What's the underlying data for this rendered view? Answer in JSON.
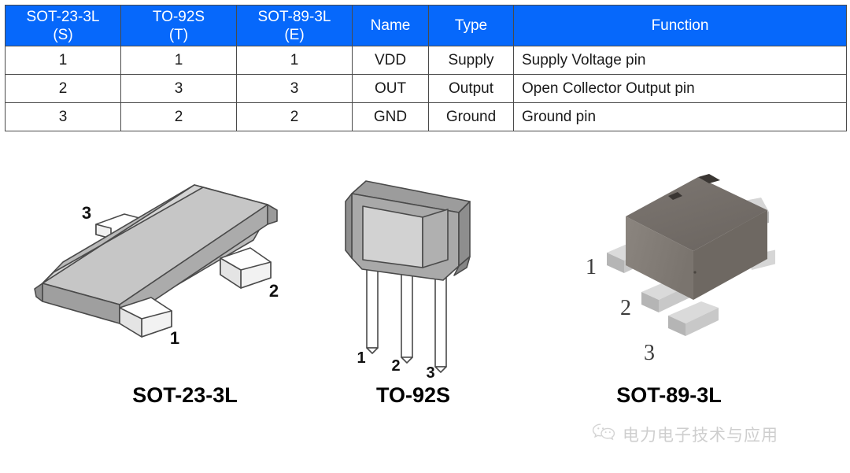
{
  "pin_table": {
    "headers": [
      {
        "line1": "SOT-23-3L",
        "line2": "(S)"
      },
      {
        "line1": "TO-92S",
        "line2": "(T)"
      },
      {
        "line1": "SOT-89-3L",
        "line2": "(E)"
      },
      {
        "line1": "Name",
        "line2": ""
      },
      {
        "line1": "Type",
        "line2": ""
      },
      {
        "line1": "Function",
        "line2": ""
      }
    ],
    "header_bg": "#0668fb",
    "header_fg": "#ffffff",
    "rows": [
      {
        "sot23": "1",
        "to92s": "1",
        "sot89": "1",
        "name": "VDD",
        "type": "Supply",
        "function": "Supply Voltage pin"
      },
      {
        "sot23": "2",
        "to92s": "3",
        "sot89": "3",
        "name": "OUT",
        "type": "Output",
        "function": "Open Collector Output pin"
      },
      {
        "sot23": "3",
        "to92s": "2",
        "sot89": "2",
        "name": "GND",
        "type": "Ground",
        "function": "Ground pin"
      }
    ]
  },
  "packages": [
    {
      "id": "sot-23-3l",
      "label": "SOT-23-3L",
      "pin_callouts": [
        "3",
        "2",
        "1"
      ],
      "body_color": "#b4b4b4",
      "body_top_color": "#c9c9c9",
      "body_side_color": "#9a9a9a",
      "lead_color": "#ffffff",
      "outline_color": "#4a4a4a"
    },
    {
      "id": "to-92s",
      "label": "TO-92S",
      "pin_callouts": [
        "1",
        "2",
        "3"
      ],
      "body_color": "#a8a8a8",
      "body_top_color": "#9c9c9c",
      "body_face_color": "#cfcfcf",
      "lead_color": "#ffffff",
      "outline_color": "#4a4a4a"
    },
    {
      "id": "sot-89-3l",
      "label": "SOT-89-3L",
      "pin_callouts": [
        "1",
        "2",
        "3"
      ],
      "body_color": "#76706c",
      "body_top_color": "#6a6560",
      "body_side_color": "#8a8580",
      "lead_color": "#cfcfcf",
      "outline_color": "#5d5954"
    }
  ],
  "watermark": {
    "text": "电力电子技术与应用",
    "icon": "wechat-icon",
    "color": "#8d8d8d"
  }
}
